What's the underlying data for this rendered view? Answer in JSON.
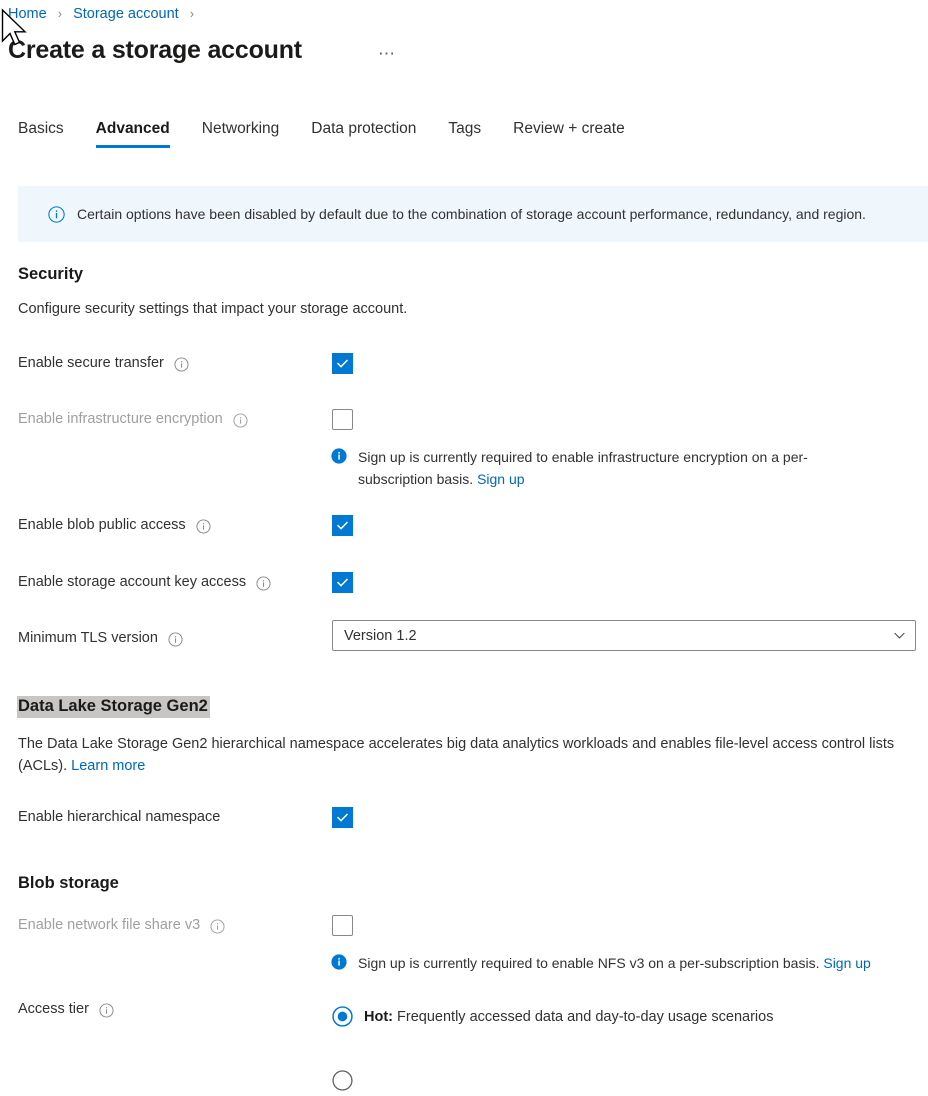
{
  "breadcrumb": {
    "items": [
      {
        "label": "Home"
      },
      {
        "label": "Storage account"
      }
    ],
    "separator": "›"
  },
  "header": {
    "title": "Create a storage account",
    "more_label": "⋯"
  },
  "tabs": [
    {
      "label": "Basics",
      "active": false
    },
    {
      "label": "Advanced",
      "active": true
    },
    {
      "label": "Networking",
      "active": false
    },
    {
      "label": "Data protection",
      "active": false
    },
    {
      "label": "Tags",
      "active": false
    },
    {
      "label": "Review + create",
      "active": false
    }
  ],
  "info_banner": {
    "icon": "info-circle-icon",
    "text": "Certain options have been disabled by default due to the combination of storage account performance, redundancy, and region.",
    "background": "#eff6fc"
  },
  "sections": {
    "security": {
      "heading": "Security",
      "description": "Configure security settings that impact your storage account.",
      "rows": {
        "secure_transfer": {
          "label": "Enable secure transfer",
          "checked": true,
          "disabled": false
        },
        "infrastructure_encryption": {
          "label": "Enable infrastructure encryption",
          "checked": false,
          "disabled": true,
          "note_text": "Sign up is currently required to enable infrastructure encryption on a per-subscription basis.",
          "note_link": "Sign up"
        },
        "blob_public_access": {
          "label": "Enable blob public access",
          "checked": true,
          "disabled": false
        },
        "key_access": {
          "label": "Enable storage account key access",
          "checked": true,
          "disabled": false
        },
        "min_tls": {
          "label": "Minimum TLS version",
          "value": "Version 1.2"
        }
      }
    },
    "data_lake": {
      "heading": "Data Lake Storage Gen2",
      "heading_highlighted": true,
      "highlight_color": "#c8c6c4",
      "description_part1": "The Data Lake Storage Gen2 hierarchical namespace accelerates big data analytics workloads and enables file-level access control lists (ACLs). ",
      "description_link": "Learn more",
      "rows": {
        "hierarchical_namespace": {
          "label": "Enable hierarchical namespace",
          "checked": true,
          "disabled": false
        }
      }
    },
    "blob_storage": {
      "heading": "Blob storage",
      "rows": {
        "nfs_v3": {
          "label": "Enable network file share v3",
          "checked": false,
          "disabled": true,
          "note_text": "Sign up is currently required to enable NFS v3 on a per-subscription basis. ",
          "note_link": "Sign up"
        },
        "access_tier": {
          "label": "Access tier",
          "options": [
            {
              "bold": "Hot:",
              "text": " Frequently accessed data and day-to-day usage scenarios",
              "selected": true
            }
          ]
        }
      }
    }
  },
  "colors": {
    "accent": "#0078d4",
    "link": "#0067b8",
    "disabled_text": "#a19f9d",
    "banner_bg": "#eff6fc"
  }
}
